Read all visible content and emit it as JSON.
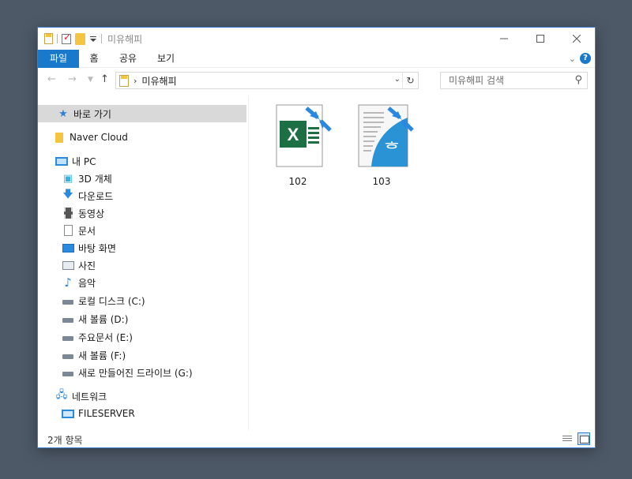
{
  "window": {
    "title": "미유해피"
  },
  "ribbon": {
    "tabs": [
      "파일",
      "홈",
      "공유",
      "보기"
    ],
    "help_label": "?"
  },
  "address_bar": {
    "path": "미유해피",
    "separator": "›"
  },
  "search": {
    "placeholder": "미유해피 검색"
  },
  "sidebar": {
    "quick_access": "바로 가기",
    "naver_cloud": "Naver Cloud",
    "this_pc": "내 PC",
    "pc_items": [
      "3D 개체",
      "다운로드",
      "동영상",
      "문서",
      "바탕 화면",
      "사진",
      "음악",
      "로컬 디스크 (C:)",
      "새 볼륨 (D:)",
      "주요문서 (E:)",
      "새 볼륨 (F:)",
      "새로 만들어진 드라이브 (G:)"
    ],
    "network": "네트워크",
    "network_items": [
      "FILESERVER"
    ]
  },
  "files": [
    {
      "name": "102",
      "icon": "excel-shortcut-icon"
    },
    {
      "name": "103",
      "icon": "hwp-shortcut-icon"
    }
  ],
  "status_bar": {
    "item_count": "2개 항목"
  },
  "colors": {
    "accent": "#1979ca",
    "excel_green": "#1d7044",
    "hwp_blue": "#2a93d5",
    "desktop_bg": "#4e5968"
  }
}
